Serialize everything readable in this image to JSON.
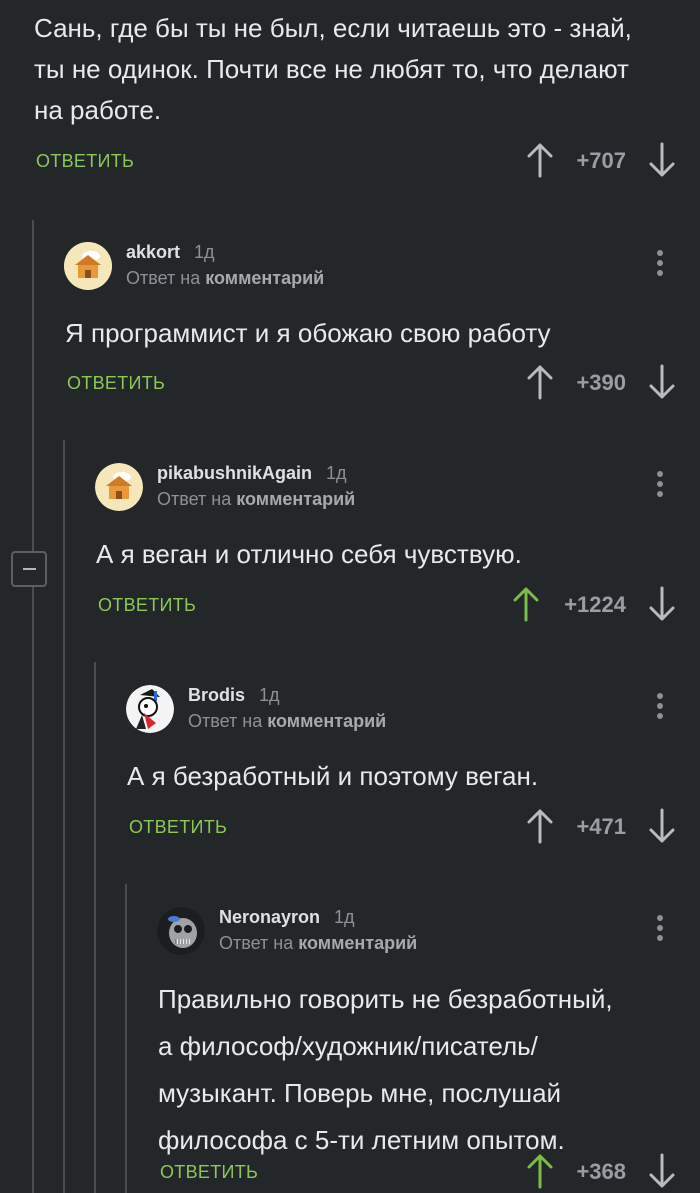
{
  "colors": {
    "background": "#24272a",
    "reply_green": "#8ac858",
    "upvote_active": "#7bbd48",
    "muted": "#8d9195",
    "thread_line": "#4a4d50"
  },
  "comments": [
    {
      "text": "Сань, где бы ты не был, если читаешь это - знай,\nты не одинок. Почти все не любят то, что делают\nна работе.",
      "reply_label": "ОТВЕТИТЬ",
      "score": "+707"
    },
    {
      "username": "akkort",
      "age": "1д",
      "reply_prefix": "Ответ на",
      "reply_target": "комментарий",
      "avatar_icon": "house-avatar-icon",
      "text": "Я программист и я обожаю свою работу",
      "reply_label": "ОТВЕТИТЬ",
      "score": "+390"
    },
    {
      "username": "pikabushnikAgain",
      "age": "1д",
      "reply_prefix": "Ответ на",
      "reply_target": "комментарий",
      "avatar_icon": "house-avatar-icon",
      "text": "А я веган и отлично себя чувствую.",
      "reply_label": "ОТВЕТИТЬ",
      "score": "+1224",
      "upvoted": true
    },
    {
      "username": "Brodis",
      "age": "1д",
      "reply_prefix": "Ответ на",
      "reply_target": "комментарий",
      "avatar_icon": "cartoon-avatar-icon",
      "text": "А я безработный и поэтому веган.",
      "reply_label": "ОТВЕТИТЬ",
      "score": "+471"
    },
    {
      "username": "Neronayron",
      "age": "1д",
      "reply_prefix": "Ответ на",
      "reply_target": "комментарий",
      "avatar_icon": "skull-avatar-icon",
      "text": "Правильно говорить не безработный,\nа философ/художник/писатель/\nмузыкант. Поверь мне, послушай\nфилософа с 5-ти летним опытом.",
      "reply_label": "ОТВЕТИТЬ",
      "score": "+368",
      "upvoted": true
    }
  ]
}
